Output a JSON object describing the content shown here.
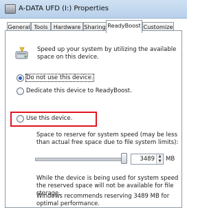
{
  "window": {
    "title": "A-DATA UFD (I:) Properties"
  },
  "tabs": [
    {
      "label": "General",
      "active": false
    },
    {
      "label": "Tools",
      "active": false
    },
    {
      "label": "Hardware",
      "active": false
    },
    {
      "label": "Sharing",
      "active": false
    },
    {
      "label": "ReadyBoost",
      "active": true
    },
    {
      "label": "Customize",
      "active": false
    }
  ],
  "readyboost": {
    "icon": "readyboost-drive-icon",
    "description": "Speed up your system by utilizing the available space on this device.",
    "options": [
      {
        "label": "Do not use this device.",
        "selected": true
      },
      {
        "label": "Dedicate this device to ReadyBoost.",
        "selected": false
      },
      {
        "label": "Use this device.",
        "selected": false
      }
    ],
    "space_label": "Space to reserve for system speed (may be less than actual free space due to file system limits):",
    "slider_fraction": 0.95,
    "space_value": "3489",
    "space_unit": "MB",
    "info_text": "While the device is being used for system speed the reserved space will not be available for file storage.",
    "recommend_text": "Windows recommends reserving 3489 MB for optimal performance."
  },
  "colors": {
    "highlight": "#e0141f",
    "titlebar": "#b7d0ea"
  }
}
